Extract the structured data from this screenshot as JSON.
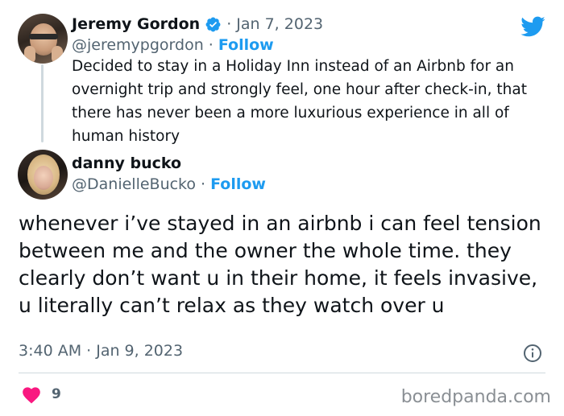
{
  "parent_tweet": {
    "author_name": "Jeremy Gordon",
    "verified": true,
    "separator": "·",
    "date": "Jan 7, 2023",
    "handle": "@jeremypgordon",
    "follow_label": "Follow",
    "text": "Decided to stay in a Holiday Inn instead of an Airbnb for an overnight trip and strongly feel, one hour after check-in, that there has never been a more luxurious experience in all of human history"
  },
  "reply_tweet": {
    "author_name": "danny bucko",
    "handle": "@DanielleBucko",
    "separator": "·",
    "follow_label": "Follow",
    "text": "whenever i’ve stayed in an airbnb i can feel tension between me and the owner the whole time. they clearly don’t want u in their home, it feels invasive, u literally can’t relax as they watch over u",
    "timestamp": "3:40 AM · Jan 9, 2023",
    "like_count": "9"
  },
  "icons": {
    "platform": "twitter-bird-icon",
    "verified": "verified-badge-icon",
    "info": "info-icon",
    "like": "heart-icon"
  },
  "colors": {
    "accent": "#1d9bf0",
    "like": "#f91880",
    "muted": "#536471",
    "text": "#0f1419"
  },
  "watermark": "boredpanda.com"
}
